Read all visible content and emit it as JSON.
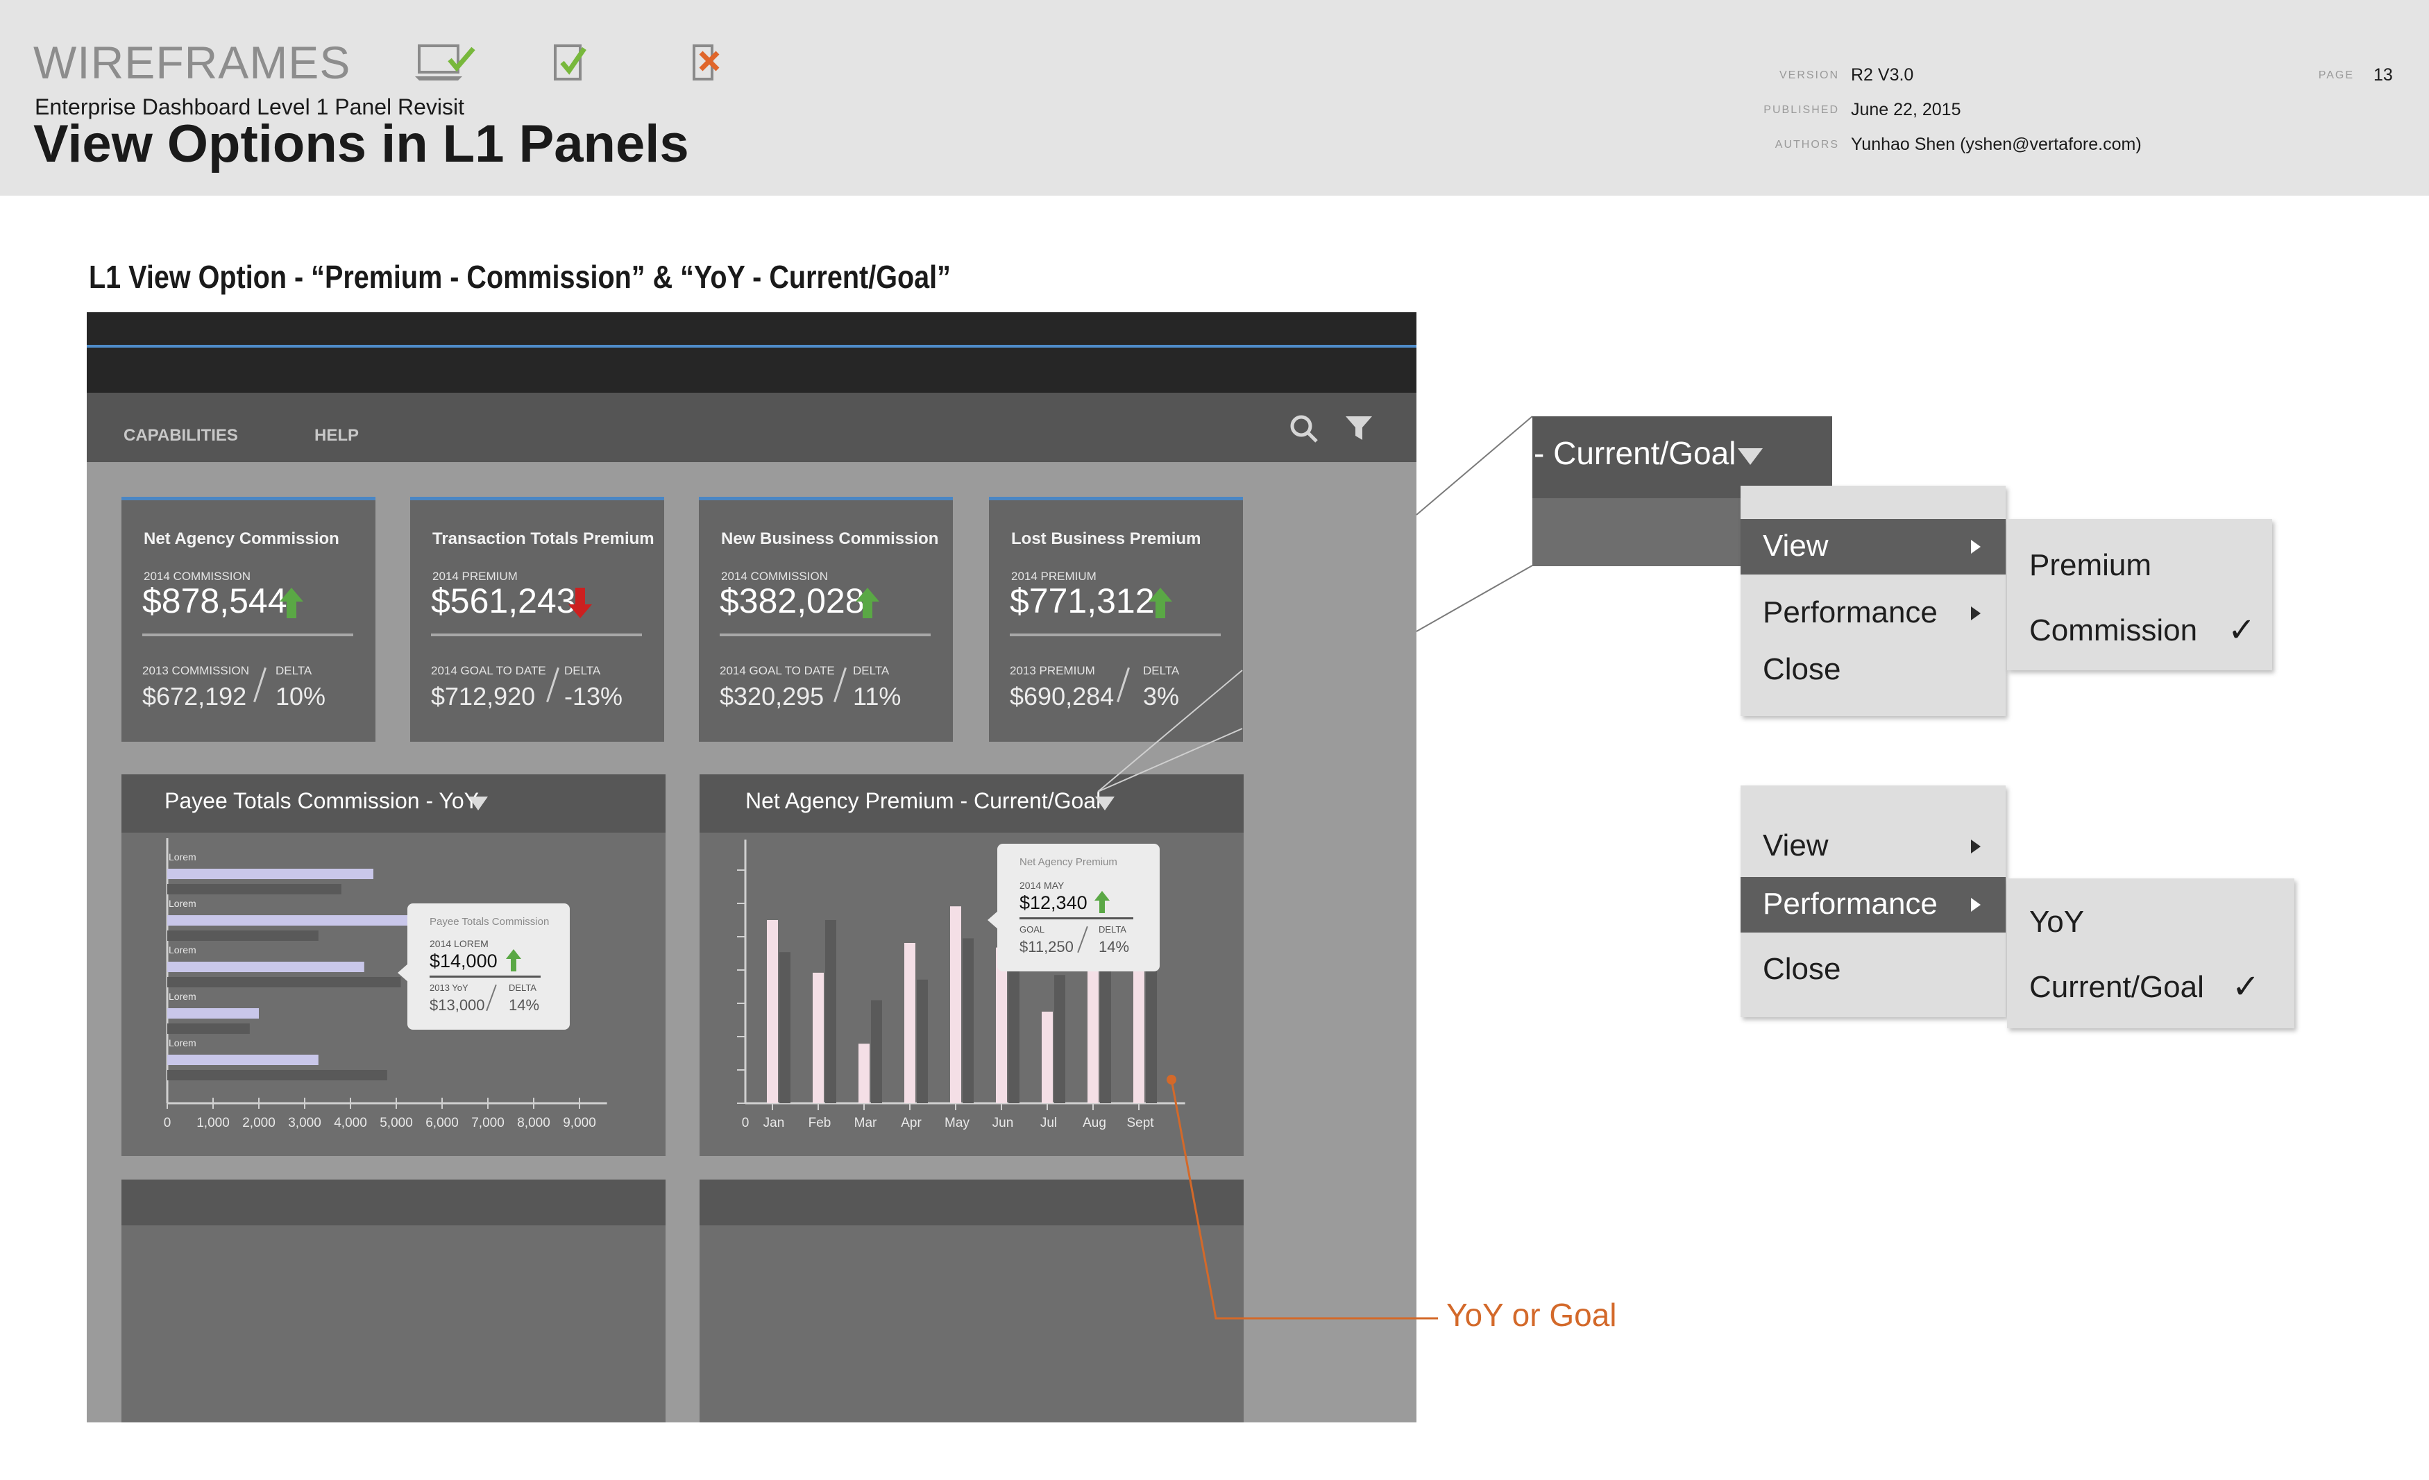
{
  "header": {
    "wireframes": "WIREFRAMES",
    "subtitle": "Enterprise Dashboard Level 1 Panel Revisit",
    "title": "View Options in L1 Panels",
    "version_label": "VERSION",
    "version": "R2 V3.0",
    "published_label": "PUBLISHED",
    "published": "June 22, 2015",
    "authors_label": "AUTHORS",
    "authors": "Yunhao Shen (yshen@vertafore.com)",
    "page_label": "PAGE",
    "page": "13",
    "device_icons": [
      "laptop-check-icon",
      "tablet-check-icon",
      "phone-cross-icon"
    ]
  },
  "section_title": "L1 View Option - “Premium - Commission” & “YoY - Current/Goal”",
  "nav": {
    "items": [
      "CAPABILITIES",
      "HELP"
    ],
    "icons": [
      "search-icon",
      "filter-icon"
    ]
  },
  "cards": [
    {
      "title": "Net Agency Commission",
      "top_label": "2014 COMMISSION",
      "value": "$878,544",
      "trend": "up",
      "bottom_label": "2013 COMMISSION",
      "bottom_value": "$672,192",
      "delta_label": "DELTA",
      "delta": "10%"
    },
    {
      "title": "Transaction Totals Premium",
      "top_label": "2014 PREMIUM",
      "value": "$561,243",
      "trend": "down",
      "bottom_label": "2014 GOAL TO DATE",
      "bottom_value": "$712,920",
      "delta_label": "DELTA",
      "delta": "-13%"
    },
    {
      "title": "New Business Commission",
      "top_label": "2014 COMMISSION",
      "value": "$382,028",
      "trend": "up",
      "bottom_label": "2014 GOAL TO DATE",
      "bottom_value": "$320,295",
      "delta_label": "DELTA",
      "delta": "11%"
    },
    {
      "title": "Lost Business Premium",
      "top_label": "2014 PREMIUM",
      "value": "$771,312",
      "trend": "up",
      "bottom_label": "2013 PREMIUM",
      "bottom_value": "$690,284",
      "delta_label": "DELTA",
      "delta": "3%"
    }
  ],
  "colors": {
    "up": "#5aa845",
    "down": "#cc2020",
    "accent": "#4a86c4",
    "callout": "#d3692a",
    "bar_light": "#c9c7ea",
    "bar_pink": "#f4dfe6"
  },
  "panels": {
    "left_title": "Payee Totals Commission - YoY",
    "right_title": "Net Agency Premium - Current/Goal"
  },
  "chart_data": [
    {
      "type": "bar",
      "orientation": "horizontal",
      "categories": [
        "Lorem",
        "Lorem",
        "Lorem",
        "Lorem",
        "Lorem"
      ],
      "series": [
        {
          "values": [
            4500,
            5300,
            4300,
            2000,
            3300
          ]
        },
        {
          "values": [
            3800,
            3300,
            5100,
            1800,
            4800
          ]
        }
      ],
      "x_ticks": [
        "0",
        "1,000",
        "2,000",
        "3,000",
        "4,000",
        "5,000",
        "6,000",
        "7,000",
        "8,000",
        "9,000"
      ],
      "xlim": [
        0,
        9600
      ],
      "tooltip": {
        "title": "Payee Totals Commission",
        "top_label": "2014 LOREM",
        "value": "$14,000",
        "bottom_label": "2013 YoY",
        "bottom_value": "$13,000",
        "delta_label": "DELTA",
        "delta": "14%"
      }
    },
    {
      "type": "bar",
      "categories": [
        "Jan",
        "Feb",
        "Mar",
        "Apr",
        "May",
        "Jun",
        "Jul",
        "Aug",
        "Sept"
      ],
      "series": [
        {
          "values": [
            80,
            57,
            26,
            70,
            86,
            68,
            40,
            78,
            82
          ]
        },
        {
          "values": [
            66,
            80,
            45,
            54,
            72,
            60,
            56,
            70,
            66
          ]
        }
      ],
      "y_label_tick": "0",
      "ylim": [
        0,
        100
      ],
      "tooltip": {
        "title": "Net Agency Premium",
        "top_label": "2014 MAY",
        "value": "$12,340",
        "bottom_label": "GOAL",
        "bottom_value": "$11,250",
        "delta_label": "DELTA",
        "delta": "14%"
      }
    }
  ],
  "dropdown_top": {
    "label": "- Current/Goal"
  },
  "menu1": {
    "items": [
      "View",
      "Performance",
      "Close"
    ],
    "selected": "View",
    "submenu": [
      "Premium",
      "Commission"
    ],
    "checked": "Commission"
  },
  "menu2": {
    "items": [
      "View",
      "Performance",
      "Close"
    ],
    "selected": "Performance",
    "submenu": [
      "YoY",
      "Current/Goal"
    ],
    "checked": "Current/Goal"
  },
  "check_mark": "✓",
  "callout": "YoY or Goal"
}
